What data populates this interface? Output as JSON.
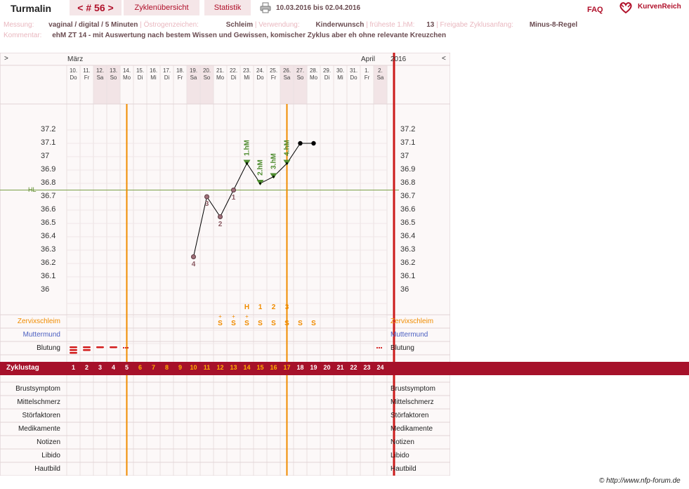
{
  "header": {
    "name": "Turmalin",
    "cycle": "< # 56 >",
    "tab_cycles": "Zyklenübersicht",
    "tab_stats": "Statistik",
    "print_icon": "printer-icon",
    "date_range": "10.03.2016 bis 02.04.2016",
    "faq": "FAQ",
    "brand": "KurvenReich",
    "brand_icon": "heart-logo-icon"
  },
  "info": {
    "messung_label": "Messung:",
    "messung_value": "vaginal / digital / 5 Minuten",
    "oestrogen_label": "Östrogenzeichen:",
    "oestrogen_value": "Schleim",
    "verwendung_label": "Verwendung:",
    "verwendung_value": "Kinderwunsch",
    "frueheste_label": "früheste 1.hM:",
    "frueheste_value": "13",
    "freigabe_label": "Freigabe Zyklusanfang:",
    "freigabe_value": "Minus-8-Regel",
    "kommentar_label": "Kommentar:",
    "kommentar_value": "ehM ZT 14 - mit Auswertung nach bestem Wissen und Gewissen, komischer Zyklus aber eh ohne relevante Kreuzchen"
  },
  "chart_nav": {
    "prev": ">",
    "next": "<",
    "month1": "März",
    "month2": "April",
    "year": "2016"
  },
  "colors": {
    "accent": "#b0102a",
    "orange": "#f08c00",
    "green": "#5c8a2a",
    "weekend": "#f2e4e6"
  },
  "chart_data": {
    "type": "line",
    "days": [
      {
        "d": "10.",
        "w": "Do"
      },
      {
        "d": "11.",
        "w": "Fr"
      },
      {
        "d": "12.",
        "w": "Sa"
      },
      {
        "d": "13.",
        "w": "So"
      },
      {
        "d": "14.",
        "w": "Mo"
      },
      {
        "d": "15.",
        "w": "Di"
      },
      {
        "d": "16.",
        "w": "Mi"
      },
      {
        "d": "17.",
        "w": "Di"
      },
      {
        "d": "18.",
        "w": "Fr"
      },
      {
        "d": "19.",
        "w": "Sa"
      },
      {
        "d": "20.",
        "w": "So"
      },
      {
        "d": "21.",
        "w": "Mo"
      },
      {
        "d": "22.",
        "w": "Di"
      },
      {
        "d": "23.",
        "w": "Mi"
      },
      {
        "d": "24.",
        "w": "Do"
      },
      {
        "d": "25.",
        "w": "Fr"
      },
      {
        "d": "26.",
        "w": "Sa"
      },
      {
        "d": "27.",
        "w": "So"
      },
      {
        "d": "28.",
        "w": "Mo"
      },
      {
        "d": "29.",
        "w": "Di"
      },
      {
        "d": "30.",
        "w": "Mi"
      },
      {
        "d": "31.",
        "w": "Do"
      },
      {
        "d": "1.",
        "w": "Fr"
      },
      {
        "d": "2.",
        "w": "Sa"
      }
    ],
    "weekend_indices": [
      2,
      3,
      9,
      10,
      16,
      17,
      23
    ],
    "cycle_days": [
      "1",
      "2",
      "3",
      "4",
      "5",
      "6",
      "7",
      "8",
      "9",
      "10",
      "11",
      "12",
      "13",
      "14",
      "15",
      "16",
      "17",
      "18",
      "19",
      "20",
      "21",
      "22",
      "23",
      "24"
    ],
    "ylim": [
      35.8,
      37.4
    ],
    "yticks": [
      "37.2",
      "37.1",
      "37",
      "36.9",
      "36.8",
      "36.7",
      "36.6",
      "36.5",
      "36.4",
      "36.3",
      "36.2",
      "36.1",
      "36"
    ],
    "temperatures": [
      {
        "day": 10,
        "value": 36.25,
        "label": "4"
      },
      {
        "day": 11,
        "value": 36.7,
        "label": "3"
      },
      {
        "day": 12,
        "value": 36.55,
        "label": "2"
      },
      {
        "day": 13,
        "value": 36.75,
        "label": "1"
      },
      {
        "day": 14,
        "value": 36.95,
        "label": "1.hM"
      },
      {
        "day": 15,
        "value": 36.8,
        "label": "2.hM"
      },
      {
        "day": 16,
        "value": 36.85,
        "label": "3.hM"
      },
      {
        "day": 17,
        "value": 36.95,
        "label": "4.hM"
      },
      {
        "day": 18,
        "value": 37.1,
        "label": ""
      },
      {
        "day": 19,
        "value": 37.1,
        "label": ""
      }
    ],
    "hl_label": "HL",
    "hl_value": 36.75,
    "vlines_days": [
      5.5,
      17.5
    ],
    "cervix_marks": [
      {
        "day": 12,
        "top": "+",
        "sym": "S"
      },
      {
        "day": 13,
        "top": "+",
        "sym": "S"
      },
      {
        "day": 14,
        "top": "+",
        "sym": "S"
      },
      {
        "day": 15,
        "top": "",
        "sym": "S"
      },
      {
        "day": 16,
        "top": "",
        "sym": "S"
      },
      {
        "day": 17,
        "top": "",
        "sym": "S"
      },
      {
        "day": 18,
        "top": "",
        "sym": "S"
      },
      {
        "day": 19,
        "top": "",
        "sym": "S"
      }
    ],
    "peak_marks": [
      {
        "day": 14,
        "label": "H"
      },
      {
        "day": 15,
        "label": "1"
      },
      {
        "day": 16,
        "label": "2"
      },
      {
        "day": 17,
        "label": "3"
      }
    ]
  },
  "rows": {
    "zervix": "Zervixschleim",
    "muttermund": "Muttermund",
    "blutung": "Blutung",
    "zyklustag": "Zyklustag",
    "bottom": [
      "Brustsymptom",
      "Mittelschmerz",
      "Störfaktoren",
      "Medikamente",
      "Notizen",
      "Libido",
      "Hautbild"
    ]
  },
  "footer": {
    "copyright": "© http://www.nfp-forum.de"
  }
}
